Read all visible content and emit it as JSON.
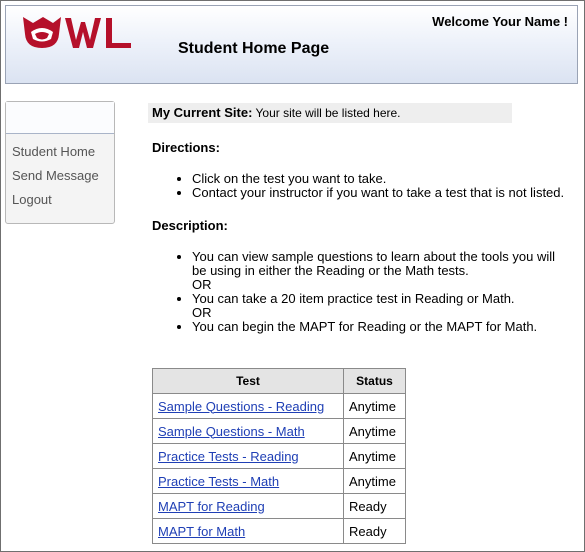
{
  "header": {
    "logo_text": "OWL",
    "welcome": "Welcome Your Name !",
    "page_title": "Student Home Page",
    "colors": {
      "brand": "#b5102a",
      "header_bg": "#dbe3f2"
    }
  },
  "sidebar": {
    "items": [
      {
        "label": "Student Home"
      },
      {
        "label": "Send Message"
      },
      {
        "label": "Logout"
      }
    ]
  },
  "site": {
    "label": "My Current Site:",
    "value": "Your site will be listed here."
  },
  "directions": {
    "title": "Directions:",
    "items": [
      "Click on the test you want to take.",
      "Contact your instructor if you want to take a test that is not listed."
    ]
  },
  "description": {
    "title": "Description:",
    "items": [
      "You can view sample questions to learn about the tools you will be using in either the Reading or the Math tests.",
      "You can take a 20 item practice test in Reading or Math.",
      "You can begin the MAPT for Reading or the MAPT for Math."
    ],
    "or_text": "OR"
  },
  "tests_table": {
    "headers": [
      "Test",
      "Status"
    ],
    "rows": [
      {
        "test": "Sample Questions - Reading",
        "status": "Anytime"
      },
      {
        "test": "Sample Questions - Math",
        "status": "Anytime"
      },
      {
        "test": "Practice Tests - Reading",
        "status": "Anytime"
      },
      {
        "test": "Practice Tests - Math",
        "status": "Anytime"
      },
      {
        "test": "MAPT for Reading",
        "status": "Ready"
      },
      {
        "test": "MAPT for Math",
        "status": "Ready"
      }
    ]
  }
}
